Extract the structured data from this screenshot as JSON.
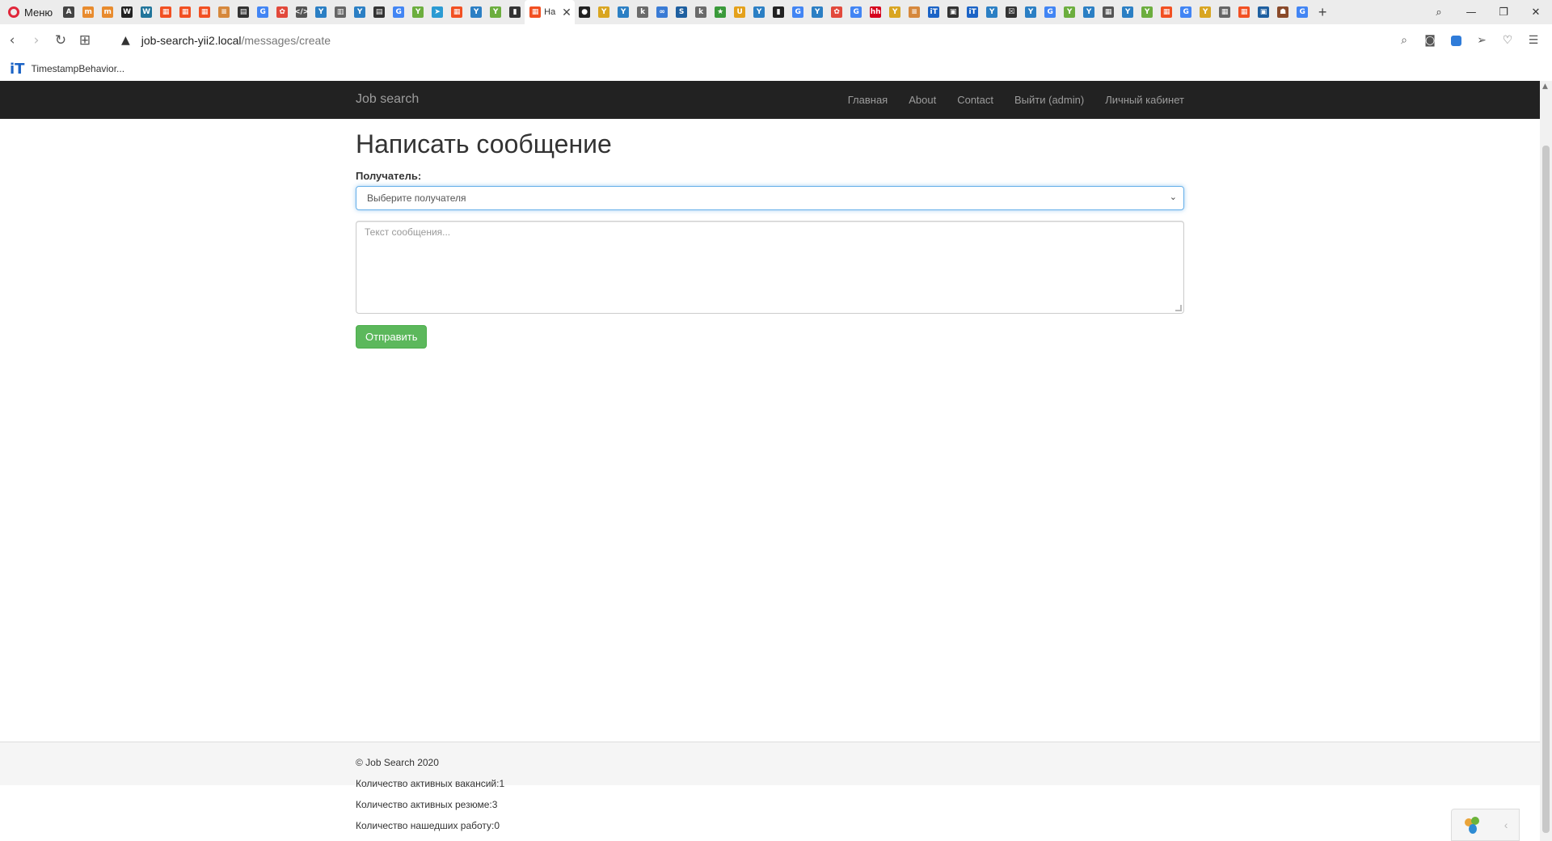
{
  "browser": {
    "menu_label": "Меню",
    "active_tab_title": "На",
    "tab_close": "✕",
    "new_tab": "+",
    "window": {
      "minimize": "—",
      "restore": "❐",
      "close": "✕"
    },
    "nav": {
      "back": "‹",
      "forward": "›",
      "reload": "↻",
      "speed_dial": "⊞"
    },
    "url": {
      "host": "job-search-yii2.local",
      "path": "/messages/create"
    },
    "bookmarks": [
      {
        "icon": "iT",
        "label": "TimestampBehavior..."
      }
    ],
    "favicons": [
      {
        "text": "A",
        "color": "#444"
      },
      {
        "text": "m",
        "color": "#e88b2e"
      },
      {
        "text": "m",
        "color": "#e88b2e"
      },
      {
        "text": "W",
        "color": "#222"
      },
      {
        "text": "W",
        "color": "#21759b"
      },
      {
        "text": "▦",
        "color": "#f25022"
      },
      {
        "text": "▦",
        "color": "#f25022"
      },
      {
        "text": "▦",
        "color": "#f25022"
      },
      {
        "text": "≡",
        "color": "#d6883c"
      },
      {
        "text": "▤",
        "color": "#333"
      },
      {
        "text": "G",
        "color": "#4285f4"
      },
      {
        "text": "✿",
        "color": "#e2493b"
      },
      {
        "text": "</>",
        "color": "#555"
      },
      {
        "text": "Y",
        "color": "#2b7fc4"
      },
      {
        "text": "▥",
        "color": "#666"
      },
      {
        "text": "Y",
        "color": "#2b7fc4"
      },
      {
        "text": "▤",
        "color": "#333"
      },
      {
        "text": "G",
        "color": "#4285f4"
      },
      {
        "text": "Y",
        "color": "#6cae3e"
      },
      {
        "text": "➤",
        "color": "#2b9bd3"
      },
      {
        "text": "▦",
        "color": "#f25022"
      },
      {
        "text": "Y",
        "color": "#2b7fc4"
      },
      {
        "text": "Y",
        "color": "#6cae3e"
      },
      {
        "text": "▮",
        "color": "#333"
      }
    ],
    "favicons_after": [
      {
        "text": "●",
        "color": "#222"
      },
      {
        "text": "Y",
        "color": "#d9a520"
      },
      {
        "text": "Y",
        "color": "#2b7fc4"
      },
      {
        "text": "k",
        "color": "#6a6a6a"
      },
      {
        "text": "∞",
        "color": "#3a7bd5"
      },
      {
        "text": "S",
        "color": "#1e5fa0"
      },
      {
        "text": "k",
        "color": "#6a6a6a"
      },
      {
        "text": "★",
        "color": "#3a9a3a"
      },
      {
        "text": "U",
        "color": "#e4a11b"
      },
      {
        "text": "Y",
        "color": "#2b7fc4"
      },
      {
        "text": "▮",
        "color": "#222"
      },
      {
        "text": "G",
        "color": "#4285f4"
      },
      {
        "text": "Y",
        "color": "#2b7fc4"
      },
      {
        "text": "✿",
        "color": "#e2493b"
      },
      {
        "text": "G",
        "color": "#4285f4"
      },
      {
        "text": "hh",
        "color": "#d6001c"
      },
      {
        "text": "Y",
        "color": "#d9a520"
      },
      {
        "text": "≡",
        "color": "#d6883c"
      },
      {
        "text": "iT",
        "color": "#1b63c6"
      },
      {
        "text": "▣",
        "color": "#333"
      },
      {
        "text": "iT",
        "color": "#1b63c6"
      },
      {
        "text": "Y",
        "color": "#2b7fc4"
      },
      {
        "text": "☒",
        "color": "#333"
      },
      {
        "text": "Y",
        "color": "#2b7fc4"
      },
      {
        "text": "G",
        "color": "#4285f4"
      },
      {
        "text": "Y",
        "color": "#6cae3e"
      },
      {
        "text": "Y",
        "color": "#2b7fc4"
      },
      {
        "text": "▦",
        "color": "#555"
      },
      {
        "text": "Y",
        "color": "#2b7fc4"
      },
      {
        "text": "Y",
        "color": "#6cae3e"
      },
      {
        "text": "▦",
        "color": "#f25022"
      },
      {
        "text": "G",
        "color": "#4285f4"
      },
      {
        "text": "Y",
        "color": "#d9a520"
      },
      {
        "text": "▦",
        "color": "#666"
      },
      {
        "text": "▦",
        "color": "#f25022"
      },
      {
        "text": "▣",
        "color": "#1e5fa0"
      },
      {
        "text": "☗",
        "color": "#8a4a2a"
      },
      {
        "text": "G",
        "color": "#4285f4"
      }
    ]
  },
  "navbar": {
    "brand": "Job search",
    "items": [
      "Главная",
      "About",
      "Contact",
      "Выйти (admin)",
      "Личный кабинет"
    ]
  },
  "form": {
    "title": "Написать сообщение",
    "recipient_label": "Получатель:",
    "recipient_selected": "Выберите получателя",
    "message_placeholder": "Текст сообщения...",
    "submit_label": "Отправить"
  },
  "footer": {
    "copyright": "© Job Search 2020",
    "stats": [
      "Количество активных вакансий:1",
      "Количество активных резюме:3",
      "Количество нашедших работу:0"
    ]
  },
  "colors": {
    "navbar_bg": "#222222",
    "navbar_text": "#9d9d9d",
    "button_success": "#5cb85c",
    "focus_border": "#66afe9"
  }
}
